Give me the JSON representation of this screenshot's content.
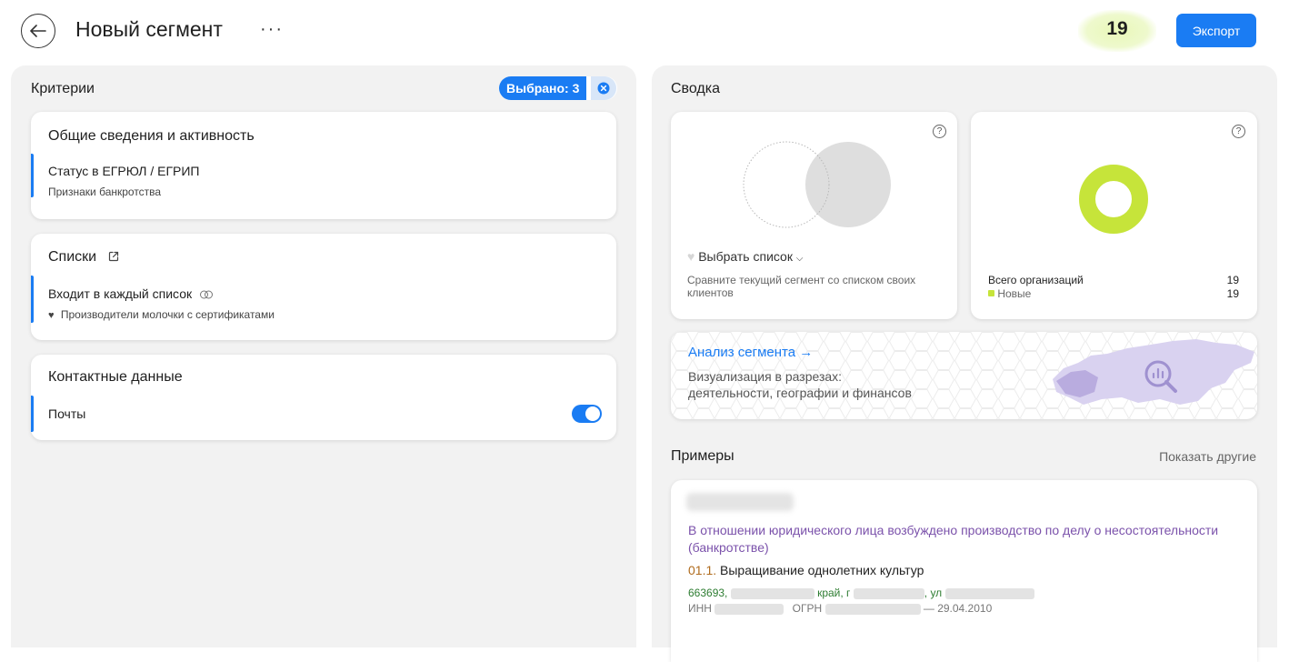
{
  "header": {
    "title": "Новый сегмент",
    "more": "···",
    "count": "19",
    "export_label": "Экспорт"
  },
  "criteria": {
    "title": "Критерии",
    "selected_label": "Выбрано: 3",
    "sections": [
      {
        "title": "Общие сведения и активность",
        "item": "Статус в ЕГРЮЛ / ЕГРИП",
        "sub": "Признаки банкротства"
      },
      {
        "title": "Списки",
        "item": "Входит в каждый список",
        "sub": "Производители молочки с сертификатами"
      },
      {
        "title": "Контактные данные",
        "item": "Почты",
        "toggle_on": true
      }
    ]
  },
  "summary": {
    "title": "Сводка",
    "compare": {
      "select_label": "Выбрать список",
      "description": "Сравните текущий сегмент со списком своих клиентов"
    },
    "donut": {
      "color": "#c6e43a",
      "total_label": "Всего организаций",
      "total_value": "19",
      "new_label": "Новые",
      "new_value": "19"
    },
    "analysis": {
      "title": "Анализ сегмента →",
      "desc_line1": "Визуализация в разрезах:",
      "desc_line2": "деятельности, географии и финансов"
    }
  },
  "examples": {
    "title": "Примеры",
    "show_other": "Показать другие",
    "item": {
      "status_text": "В отношении юридического лица возбуждено производство по делу о несостоятельности (банкротстве)",
      "okved_code": "01.1.",
      "okved_name": "Выращивание однолетних культур",
      "address_zip": "663693,",
      "address_krai": "край, г",
      "address_ul": ", ул",
      "inn_label": "ИНН",
      "ogrn_label": "ОГРН",
      "date": "— 29.04.2010"
    }
  },
  "colors": {
    "accent": "#1a7cf3",
    "donut": "#c6e43a",
    "status_purple": "#7b52ab",
    "address_green": "#2e7d32",
    "okved_brown": "#b06c1e"
  }
}
